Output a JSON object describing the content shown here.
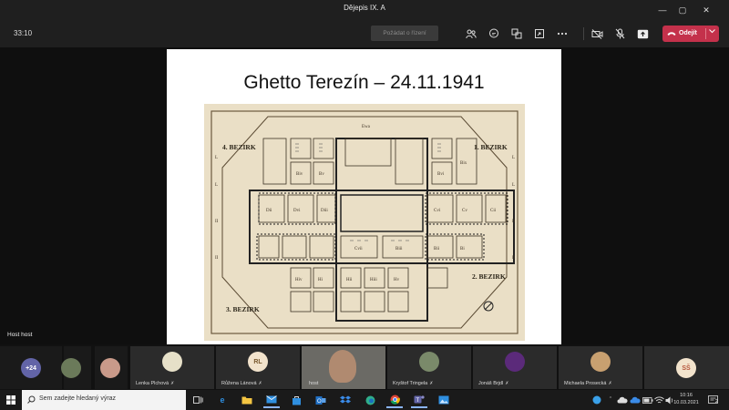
{
  "window": {
    "title": "Dějepis IX. A"
  },
  "toolbar": {
    "timer": "33:10",
    "raise_hand": "Požádat o řízení",
    "leave_label": "Odejít",
    "icons": [
      "participants-icon",
      "chat-icon",
      "breakout-rooms-icon",
      "share-tray-icon",
      "more-actions-icon",
      "camera-off-icon",
      "mic-muted-icon",
      "share-screen-icon"
    ]
  },
  "stage": {
    "slide_title": "Ghetto Terezín – 24.11.1941",
    "presenter_label": "Host host",
    "map": {
      "district_labels": [
        "4. BEZIRK",
        "1. BEZIRK",
        "2. BEZIRK",
        "3. BEZIRK"
      ],
      "block_labels": [
        "Ewa",
        "Biv",
        "Bv",
        "Bvi",
        "Bix",
        "Dii",
        "Dvi",
        "Diii",
        "Cvi",
        "Cv",
        "Cii",
        "Cvii",
        "Biii",
        "Bii",
        "Bi",
        "Hiv",
        "Hi",
        "Hii",
        "Hiii",
        "Hv"
      ]
    }
  },
  "participants": {
    "overflow_count": "+24",
    "tiles": [
      {
        "name": "",
        "initials": "",
        "kind": "avatar-photo"
      },
      {
        "name": "",
        "initials": "",
        "kind": "avatar-photo"
      },
      {
        "name": "Lenka Plchová",
        "initials": "",
        "kind": "avatar-photo"
      },
      {
        "name": "Růžena Lánová",
        "initials": "RL",
        "kind": "initials"
      },
      {
        "name": "host",
        "initials": "",
        "kind": "video"
      },
      {
        "name": "Kryštof Tringela",
        "initials": "",
        "kind": "avatar-photo"
      },
      {
        "name": "Jonáš Brjdl",
        "initials": "",
        "kind": "avatar-photo"
      },
      {
        "name": "Michaela Prosecká",
        "initials": "",
        "kind": "avatar-photo"
      },
      {
        "name": "",
        "initials": "SŠ",
        "kind": "initials"
      }
    ]
  },
  "taskbar": {
    "search_placeholder": "Sem zadejte hledaný výraz",
    "time": "10:16",
    "date": "10.03.2021",
    "notifications": "2"
  },
  "colors": {
    "leave_red": "#c4314b",
    "teams_purple": "#6264a7"
  }
}
